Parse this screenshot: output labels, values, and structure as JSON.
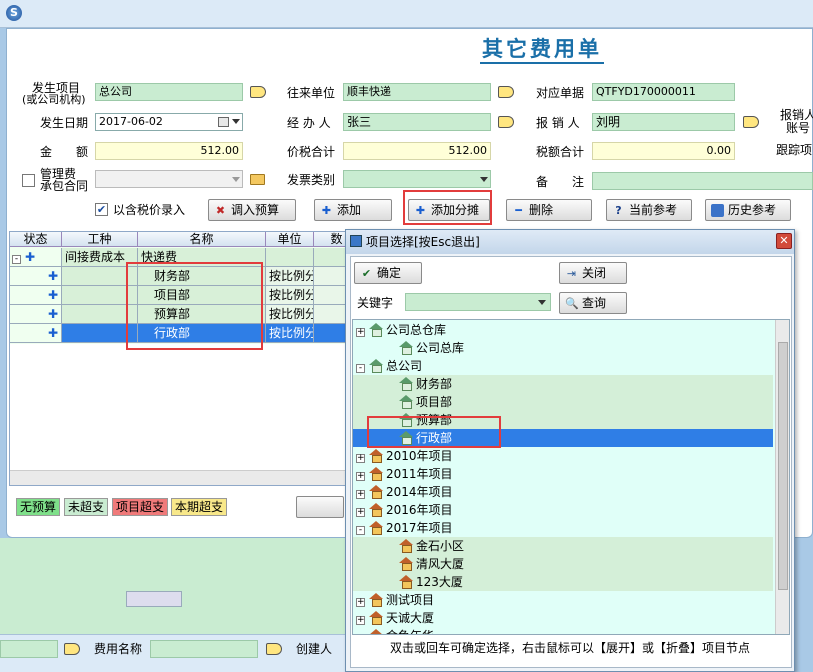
{
  "window": {
    "title": "其它费用单"
  },
  "form": {
    "project_label": "发生项目\n(或公司机构)",
    "project_label_1": "发生项目",
    "project_label_2": "(或公司机构)",
    "project_value": "总公司",
    "counterparty_label": "往来单位",
    "counterparty_value": "顺丰快递",
    "ref_doc_label": "对应单据",
    "ref_doc_value": "QTFYD170000011",
    "reimburser_account_label_1": "报销人",
    "reimburser_account_label_2": "账号",
    "date_label": "发生日期",
    "date_value": "2017-06-02",
    "handler_label": "经 办 人",
    "handler_value": "张三",
    "reimburser_label": "报 销 人",
    "reimburser_value": "刘明",
    "amount_label": "金　　额",
    "amount_value": "512.00",
    "total_label": "价税合计",
    "total_value": "512.00",
    "tax_label": "税额合计",
    "tax_value": "0.00",
    "tracking_label": "跟踪项",
    "mgmt_fee_label_1": "管理费",
    "mgmt_fee_label_2": "承包合同",
    "invoice_type_label": "发票类别",
    "remark_label": "备　　注",
    "tax_inclusive_label": "以含税价录入"
  },
  "toolbar": {
    "import_budget": "调入预算",
    "add": "添加",
    "add_allocation": "添加分摊",
    "delete": "删除",
    "current_ref": "当前参考",
    "history_ref": "历史参考"
  },
  "grid": {
    "columns": [
      "状态",
      "工种",
      "名称",
      "单位",
      "数"
    ],
    "group_row": {
      "type": "间接费成本",
      "name": "快递费"
    },
    "rows": [
      {
        "name": "财务部",
        "unit": "按比例分"
      },
      {
        "name": "项目部",
        "unit": "按比例分"
      },
      {
        "name": "预算部",
        "unit": "按比例分"
      },
      {
        "name": "行政部",
        "unit": "按比例分"
      }
    ]
  },
  "legend": {
    "no_budget": "无预算",
    "not_exceeded": "未超支",
    "project_exceeded": "项目超支",
    "period_exceeded": "本期超支"
  },
  "bottom": {
    "fee_name_label": "费用名称",
    "creator_label": "创建人"
  },
  "dialog": {
    "title": "项目选择[按Esc退出]",
    "confirm": "确定",
    "close": "关闭",
    "keyword_label": "关键字",
    "query": "查询",
    "footer": "双击或回车可确定选择，右击鼠标可以【展开】或【折叠】项目节点",
    "tree": [
      {
        "label": "公司总仓库",
        "level": 0,
        "exp": "+",
        "icon": "g"
      },
      {
        "label": "公司总库",
        "level": 1,
        "exp": "",
        "icon": "g"
      },
      {
        "label": "总公司",
        "level": 0,
        "exp": "-",
        "icon": "g"
      },
      {
        "label": "财务部",
        "level": 1,
        "exp": "",
        "icon": "g"
      },
      {
        "label": "项目部",
        "level": 1,
        "exp": "",
        "icon": "g"
      },
      {
        "label": "预算部",
        "level": 1,
        "exp": "",
        "icon": "g"
      },
      {
        "label": "行政部",
        "level": 1,
        "exp": "",
        "icon": "g",
        "selected": true
      },
      {
        "label": "2010年项目",
        "level": 0,
        "exp": "+",
        "icon": "o"
      },
      {
        "label": "2011年项目",
        "level": 0,
        "exp": "+",
        "icon": "o"
      },
      {
        "label": "2014年项目",
        "level": 0,
        "exp": "+",
        "icon": "o"
      },
      {
        "label": "2016年项目",
        "level": 0,
        "exp": "+",
        "icon": "o"
      },
      {
        "label": "2017年项目",
        "level": 0,
        "exp": "-",
        "icon": "o"
      },
      {
        "label": "金石小区",
        "level": 1,
        "exp": "",
        "icon": "o"
      },
      {
        "label": "清风大厦",
        "level": 1,
        "exp": "",
        "icon": "o"
      },
      {
        "label": "123大厦",
        "level": 1,
        "exp": "",
        "icon": "o"
      },
      {
        "label": "测试项目",
        "level": 0,
        "exp": "+",
        "icon": "o"
      },
      {
        "label": "天诚大厦",
        "level": 0,
        "exp": "+",
        "icon": "o"
      },
      {
        "label": "金鱼年华",
        "level": 0,
        "exp": "+",
        "icon": "o"
      }
    ]
  }
}
